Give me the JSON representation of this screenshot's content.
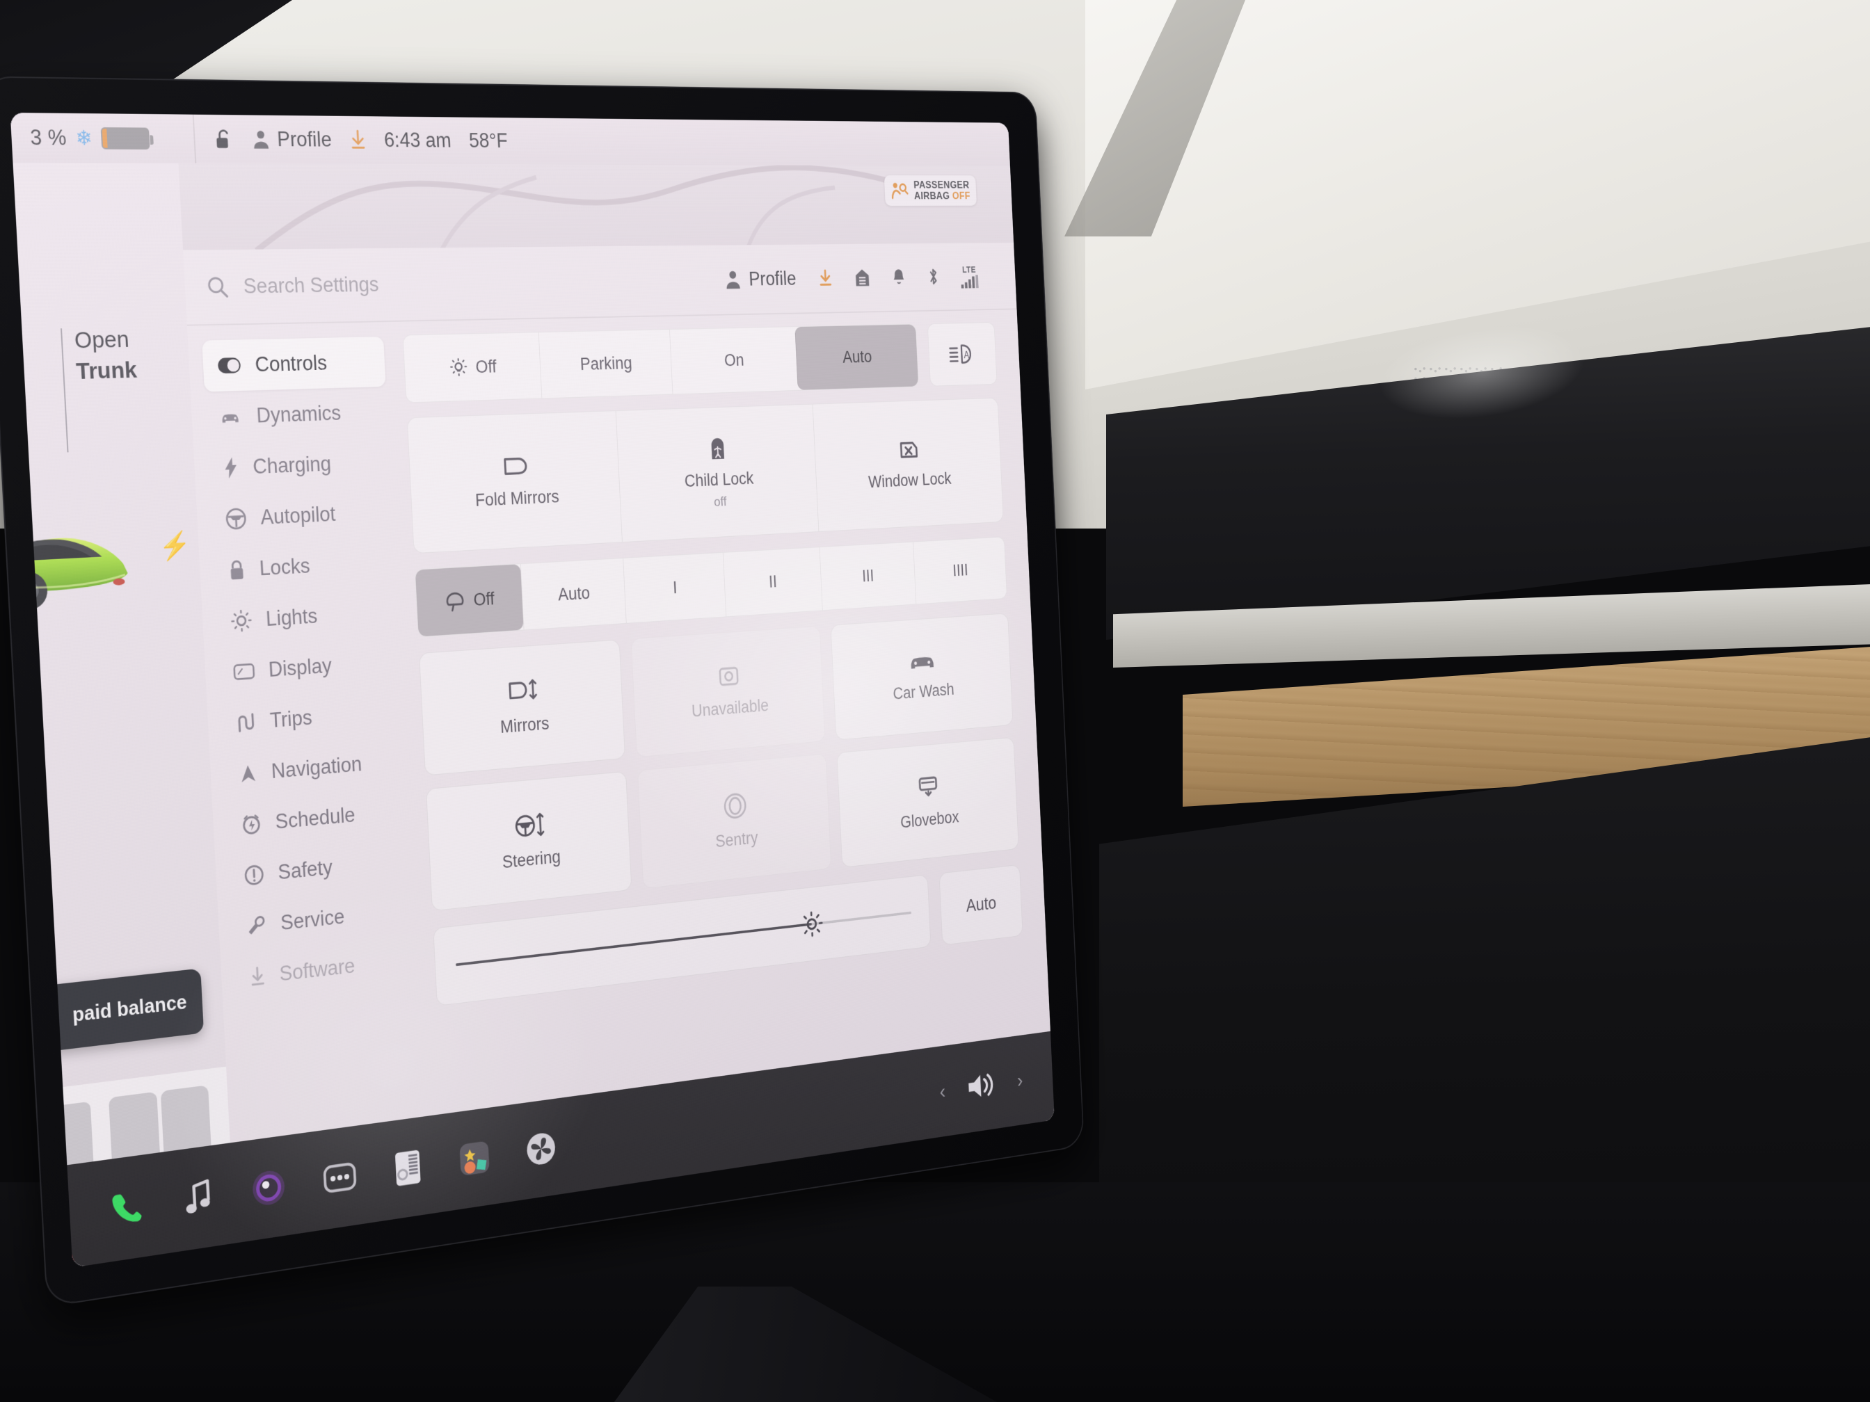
{
  "status_bar": {
    "battery_percent": "3 %",
    "snowflake_icon": "snowflake-icon",
    "battery_icon": "battery-icon",
    "lock_icon": "unlocked-padlock-icon",
    "profile_icon": "profile-person-icon",
    "profile_label": "Profile",
    "download_icon": "software-download-icon",
    "time": "6:43 am",
    "temperature": "58°F"
  },
  "airbag_indicator": {
    "icon": "passenger-airbag-icon",
    "line1": "PASSENGER",
    "line2": "AIRBAG",
    "state": "OFF"
  },
  "left_panel": {
    "trunk_action": "Open",
    "trunk_target": "Trunk",
    "bolt_icon": "charge-port-bolt-icon",
    "car_image_alt": "green-tesla-car-render",
    "toast_text": "paid balance",
    "seat_diagram_alt": "seat-layout-diagram",
    "seatbelt_warning_icon": "seatbelt-warning-icon"
  },
  "settings": {
    "search": {
      "icon": "search-icon",
      "placeholder": "Search Settings"
    },
    "header_icons": {
      "profile_icon": "profile-person-icon",
      "profile_label": "Profile",
      "download_icon": "download-icon",
      "garage_icon": "garage-door-icon",
      "bell_icon": "notification-bell-icon",
      "bluetooth_icon": "bluetooth-icon",
      "signal_label": "LTE",
      "signal_icon": "cellular-signal-icon"
    },
    "sidebar": {
      "items": [
        {
          "label": "Controls",
          "icon": "controls-toggle-icon",
          "active": true,
          "dim": false
        },
        {
          "label": "Dynamics",
          "icon": "car-front-icon",
          "active": false,
          "dim": false
        },
        {
          "label": "Charging",
          "icon": "charging-bolt-icon",
          "active": false,
          "dim": false
        },
        {
          "label": "Autopilot",
          "icon": "steering-wheel-icon",
          "active": false,
          "dim": false
        },
        {
          "label": "Locks",
          "icon": "padlock-icon",
          "active": false,
          "dim": false
        },
        {
          "label": "Lights",
          "icon": "light-bulb-icon",
          "active": false,
          "dim": false
        },
        {
          "label": "Display",
          "icon": "display-screen-icon",
          "active": false,
          "dim": false
        },
        {
          "label": "Trips",
          "icon": "trip-route-icon",
          "active": false,
          "dim": false
        },
        {
          "label": "Navigation",
          "icon": "navigation-arrow-icon",
          "active": false,
          "dim": false
        },
        {
          "label": "Schedule",
          "icon": "schedule-clock-icon",
          "active": false,
          "dim": false
        },
        {
          "label": "Safety",
          "icon": "safety-alert-icon",
          "active": false,
          "dim": false
        },
        {
          "label": "Service",
          "icon": "wrench-icon",
          "active": false,
          "dim": false
        },
        {
          "label": "Software",
          "icon": "software-download-icon",
          "active": false,
          "dim": true
        }
      ]
    },
    "headlights": {
      "icon": "headlight-bulb-icon",
      "options": [
        "Off",
        "Parking",
        "On",
        "Auto"
      ],
      "selected": "Auto",
      "high_beam_button_icon": "auto-high-beam-icon"
    },
    "mirror_lock_row": [
      {
        "label": "Fold Mirrors",
        "sub": "",
        "icon": "side-mirror-icon"
      },
      {
        "label": "Child Lock",
        "sub": "off",
        "icon": "child-lock-icon"
      },
      {
        "label": "Window Lock",
        "sub": "",
        "icon": "window-lock-icon"
      }
    ],
    "wipers": {
      "icon": "wiper-blade-icon",
      "options": [
        "Off",
        "Auto",
        "I",
        "II",
        "III",
        "IIII"
      ],
      "selected": "Off"
    },
    "quick_cards": [
      {
        "label": "Mirrors",
        "icon": "mirror-adjust-icon",
        "disabled": false
      },
      {
        "label": "Unavailable",
        "icon": "camera-icon",
        "disabled": true
      },
      {
        "label": "Car Wash",
        "icon": "car-wash-icon",
        "disabled": false
      },
      {
        "label": "Steering",
        "icon": "steering-adjust-icon",
        "disabled": false
      },
      {
        "label": "Sentry",
        "icon": "sentry-mode-icon",
        "disabled": true
      },
      {
        "label": "Glovebox",
        "icon": "glovebox-icon",
        "disabled": false
      }
    ],
    "brightness": {
      "icon": "brightness-sun-icon",
      "value_percent": 77,
      "auto_label": "Auto"
    }
  },
  "dock": {
    "items": [
      {
        "name": "phone-icon",
        "label": "Phone"
      },
      {
        "name": "music-icon",
        "label": "Media"
      },
      {
        "name": "dashcam-icon",
        "label": "Dashcam"
      },
      {
        "name": "more-apps-icon",
        "label": "More"
      },
      {
        "name": "tuner-icon",
        "label": "Radio"
      },
      {
        "name": "apps-icon",
        "label": "Apps"
      },
      {
        "name": "climate-fan-icon",
        "label": "Climate"
      }
    ],
    "volume": {
      "prev_icon": "chevron-left-icon",
      "speaker_icon": "volume-speaker-icon",
      "next_icon": "chevron-right-icon"
    }
  },
  "colors": {
    "accent_orange": "#e08a32",
    "selected_gray": "#b4aeb4",
    "warning_red": "#e8252b",
    "screen_bg": "#ece4ea"
  }
}
